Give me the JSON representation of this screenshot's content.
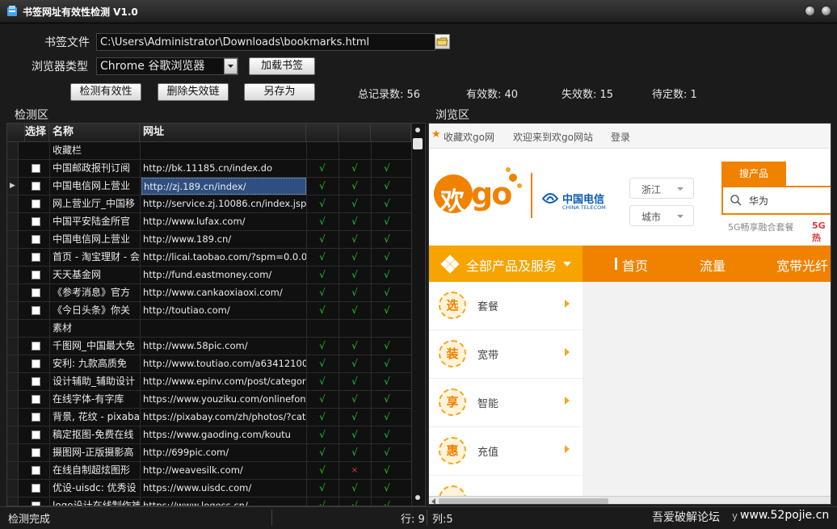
{
  "window": {
    "title": "书签网址有效性检测 V1.0"
  },
  "form": {
    "bookmark_label": "书签文件",
    "bookmark_path": "C:\\Users\\Administrator\\Downloads\\bookmarks.html",
    "browser_type_label": "浏览器类型",
    "browser_type_value": "Chrome 谷歌浏览器",
    "load_button": "加载书签",
    "check_button": "检测有效性",
    "delete_button": "删除失效链",
    "save_as_button": "另存为"
  },
  "stats": {
    "total": "总记录数: 56",
    "valid": "有效数: 40",
    "invalid": "失效数: 15",
    "pending": "待定数: 1"
  },
  "sections": {
    "check_area": "检测区",
    "browse_area": "浏览区"
  },
  "grid": {
    "headers": {
      "select": "选择",
      "name": "名称",
      "url": "网址"
    },
    "rows": [
      {
        "group": true,
        "name": "收藏栏",
        "url": "",
        "c1": "",
        "c2": "",
        "c3": ""
      },
      {
        "name": "中国邮政报刊订阅",
        "url": "http://bk.11185.cn/index.do",
        "c1": "√",
        "c2": "√",
        "c3": "√"
      },
      {
        "name": "中国电信网上营业",
        "url": "http://zj.189.cn/index/",
        "c1": "√",
        "c2": "√",
        "c3": "√",
        "current": true
      },
      {
        "name": "网上营业厅_中国移",
        "url": "http://service.zj.10086.cn/index.jsp?aiss",
        "c1": "√",
        "c2": "√",
        "c3": "√"
      },
      {
        "name": "中国平安陆金所官",
        "url": "http://www.lufax.com/",
        "c1": "√",
        "c2": "√",
        "c3": "√"
      },
      {
        "name": "中国电信网上营业",
        "url": "http://www.189.cn/",
        "c1": "√",
        "c2": "√",
        "c3": "√"
      },
      {
        "name": "首页 - 淘宝理财 - 会",
        "url": "http://licai.taobao.com/?spm=0.0.0.0.9o",
        "c1": "√",
        "c2": "√",
        "c3": "√"
      },
      {
        "name": "天天基金网",
        "url": "http://fund.eastmoney.com/",
        "c1": "√",
        "c2": "√",
        "c3": "√"
      },
      {
        "name": "《参考消息》官方",
        "url": "http://www.cankaoxiaoxi.com/",
        "c1": "√",
        "c2": "√",
        "c3": "√"
      },
      {
        "name": "《今日头条》你关",
        "url": "http://toutiao.com/",
        "c1": "√",
        "c2": "√",
        "c3": "√"
      },
      {
        "group": true,
        "name": "素材",
        "url": "",
        "c1": "",
        "c2": "",
        "c3": ""
      },
      {
        "name": "千图网_中国最大免",
        "url": "http://www.58pic.com/",
        "c1": "√",
        "c2": "√",
        "c3": "√"
      },
      {
        "name": "安利: 九款高质免",
        "url": "http://www.toutiao.com/a634121008432",
        "c1": "√",
        "c2": "√",
        "c3": "√"
      },
      {
        "name": "设计辅助_辅助设计",
        "url": "http://www.epinv.com/post/category/ot",
        "c1": "√",
        "c2": "√",
        "c3": "√"
      },
      {
        "name": "在线字体-有字库",
        "url": "https://www.youziku.com/onlinefont/ind",
        "c1": "√",
        "c2": "√",
        "c3": "√"
      },
      {
        "name": "背景, 花纹 - pixabay",
        "url": "https://pixabay.com/zh/photos/?cat=bac",
        "c1": "√",
        "c2": "√",
        "c3": "√"
      },
      {
        "name": "稿定抠图-免费在线",
        "url": "https://www.gaoding.com/koutu",
        "c1": "√",
        "c2": "√",
        "c3": "√"
      },
      {
        "name": "摄图网-正版摄影高",
        "url": "http://699pic.com/",
        "c1": "√",
        "c2": "√",
        "c3": "√"
      },
      {
        "name": "在线自制超炫图形",
        "url": "http://weavesilk.com/",
        "c1": "√",
        "c2": "×",
        "c3": "√"
      },
      {
        "name": "优设-uisdc: 优秀设",
        "url": "https://www.uisdc.com/",
        "c1": "√",
        "c2": "√",
        "c3": "√"
      },
      {
        "name": "logo设计在线制作神",
        "url": "https://www.logoss.cn/",
        "c1": "√",
        "c2": "√",
        "c3": "√"
      }
    ]
  },
  "browser": {
    "topbar": {
      "fav": "收藏欢go网",
      "welcome": "欢迎来到欢go网站",
      "login": "登录"
    },
    "logo_text": "欢go",
    "telecom_cn": "中国电信",
    "telecom_en": "CHINA TELECOM",
    "region": "浙江",
    "city": "城市",
    "search_tab": "搜产品",
    "search_value": "华为",
    "promo": "5G畅享融合套餐",
    "promo_hot": "5G热",
    "nav": {
      "all": "全部产品及服务",
      "home": "首页",
      "traffic": "流量",
      "broadband": "宽带光纤"
    },
    "menu": [
      {
        "icon": "选",
        "label": "套餐"
      },
      {
        "icon": "装",
        "label": "宽带"
      },
      {
        "icon": "享",
        "label": "智能"
      },
      {
        "icon": "惠",
        "label": "充值"
      },
      {
        "icon": "",
        "label": ""
      }
    ]
  },
  "status": {
    "message": "检测完成",
    "row": "行: 9",
    "col": "列:5",
    "watermark": "吾爱破解论坛",
    "watermark_url": "www.52pojie.cn",
    "extra": "y"
  },
  "colors": {
    "accent_orange": "#f08200",
    "check_green": "#27c427",
    "fail_red": "#e23b3b"
  }
}
